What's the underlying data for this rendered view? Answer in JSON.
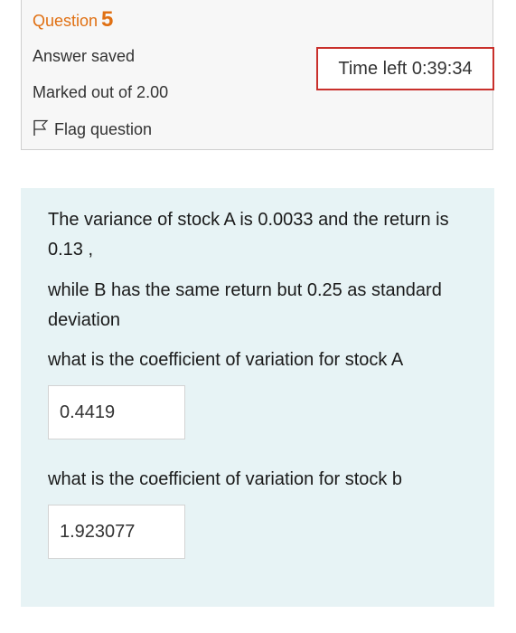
{
  "question": {
    "label": "Question",
    "number": "5",
    "status": "Answer saved",
    "marks": "Marked out of 2.00",
    "flag_label": "Flag question"
  },
  "timer": {
    "text": "Time left 0:39:34"
  },
  "content": {
    "para1": "The variance of stock A is 0.0033 and the return is 0.13 ,",
    "para2": "while B has the same return but 0.25 as standard deviation",
    "prompt_a": "what is the coefficient of variation for stock A",
    "answer_a": "0.4419",
    "prompt_b": "what is the coefficient of variation for stock b",
    "answer_b": "1.923077"
  },
  "colors": {
    "accent": "#e07013",
    "timer_border": "#c9302c",
    "content_bg": "#e7f3f5",
    "info_bg": "#f7f7f7"
  },
  "icons": {
    "flag": "flag-icon"
  }
}
